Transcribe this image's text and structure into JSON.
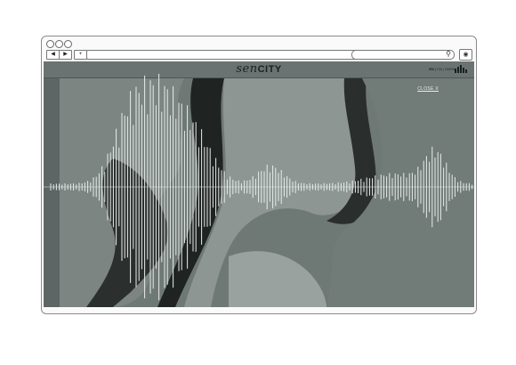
{
  "browser": {
    "back": "◀",
    "forward": "▶",
    "new_tab": "+",
    "reload": "↻",
    "search": "⚲",
    "settings": "◉"
  },
  "site": {
    "logo_a": "sen",
    "logo_b": "CITY",
    "languages": [
      "EN",
      "ITA",
      "SVEN"
    ],
    "active_language": "EN",
    "close": "CLOSE X"
  },
  "colors": {
    "background": "#5d6664",
    "header": "#6b7372",
    "wave": "#e8ecea"
  },
  "icons": [
    "back-arrow-icon",
    "forward-arrow-icon",
    "plus-icon",
    "reload-icon",
    "search-icon",
    "settings-icon",
    "skyline-icon"
  ]
}
